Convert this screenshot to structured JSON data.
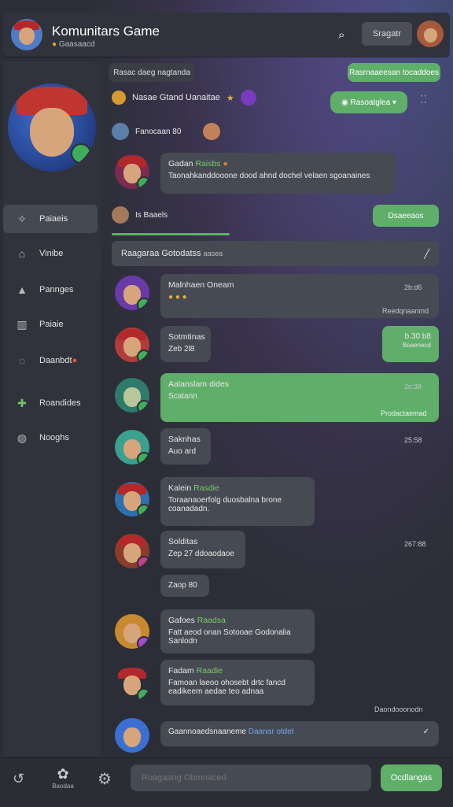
{
  "header": {
    "title": "Komunitars Game",
    "subtitle": "Gaasaacd",
    "search_label": "Sragatr"
  },
  "sidebar": {
    "items": [
      {
        "label": "Paiaeis",
        "icon": "sparkle-icon"
      },
      {
        "label": "Vinibe",
        "icon": "home-icon"
      },
      {
        "label": "Pannges",
        "icon": "bell-icon"
      },
      {
        "label": "Paiaie",
        "icon": "book-icon"
      },
      {
        "label": "Daanbdt",
        "icon": "chat-icon"
      },
      {
        "label": "Roandides",
        "icon": "gamepad-icon"
      },
      {
        "label": "Nooghs",
        "icon": "discord-icon"
      }
    ]
  },
  "feed": {
    "date_label": "Rasac daeg nagtanda",
    "pill_top_right": "Rasrnaaeesan tocaddoes",
    "event_line": "Nasae Gtand Uanaitae",
    "pill_status": "Rasoatglea",
    "pin_line": "Fanocaan 80",
    "first_msg": {
      "name": "Gadan",
      "name_hl": "Raisbs",
      "text": "Taonahkanddooone dood ahnd dochel velaen sgoanaines"
    },
    "user_line": "Is Baaels",
    "pill_reply": "Dsaeeaos",
    "banner": "Raagaraa Gotodatss",
    "banner_tail": "aasea",
    "messages": [
      {
        "name": "Malnhaen Oneam",
        "text": "",
        "time": "2b:d6",
        "footer": "Reedqnaanmd"
      },
      {
        "name": "Sotmtinas",
        "text": "Zeb 2l8",
        "time": "",
        "footer": ""
      },
      {
        "name": "Aalanslam dides",
        "text": "Scatann",
        "time": "2c:38",
        "footer": "Prodactaemad"
      },
      {
        "name": "Saknhas",
        "text": "Auo ard",
        "time": "25:58",
        "footer": ""
      },
      {
        "name": "Kalein",
        "name_hl": "Rasdie",
        "text": "Toraanaoerfolg duosbalna brone coanadadn.",
        "time": "",
        "footer": ""
      },
      {
        "name": "Solditas",
        "text": "Zep 27 ddoaodaoe",
        "time": "267:88",
        "footer": ""
      },
      {
        "name": "",
        "text": "Zaop 80",
        "time": "",
        "footer": ""
      },
      {
        "name": "Gafoes",
        "name_hl": "Raadsa",
        "text": "Fatt aeod onan Sotooae Godonalia Sanlodn",
        "time": "",
        "footer": ""
      },
      {
        "name": "Fadam",
        "name_hl": "Raadie",
        "text": "Famoan laeoo ohosebt drtc fancd eadikeem aedae teo adnaa",
        "time": "",
        "footer": "Daondooonodn"
      },
      {
        "name": "",
        "text": "Gaannoaedsnaaneme",
        "name_hl": "Daanar otdet",
        "time": "",
        "footer": ""
      }
    ],
    "right_box": {
      "time": "b.30:b8",
      "label": "Boaenecd"
    }
  },
  "composer": {
    "placeholder": "Ruagaang Obmnaced",
    "send_label": "Ocdlangas",
    "tab_label": "Baodaa"
  }
}
